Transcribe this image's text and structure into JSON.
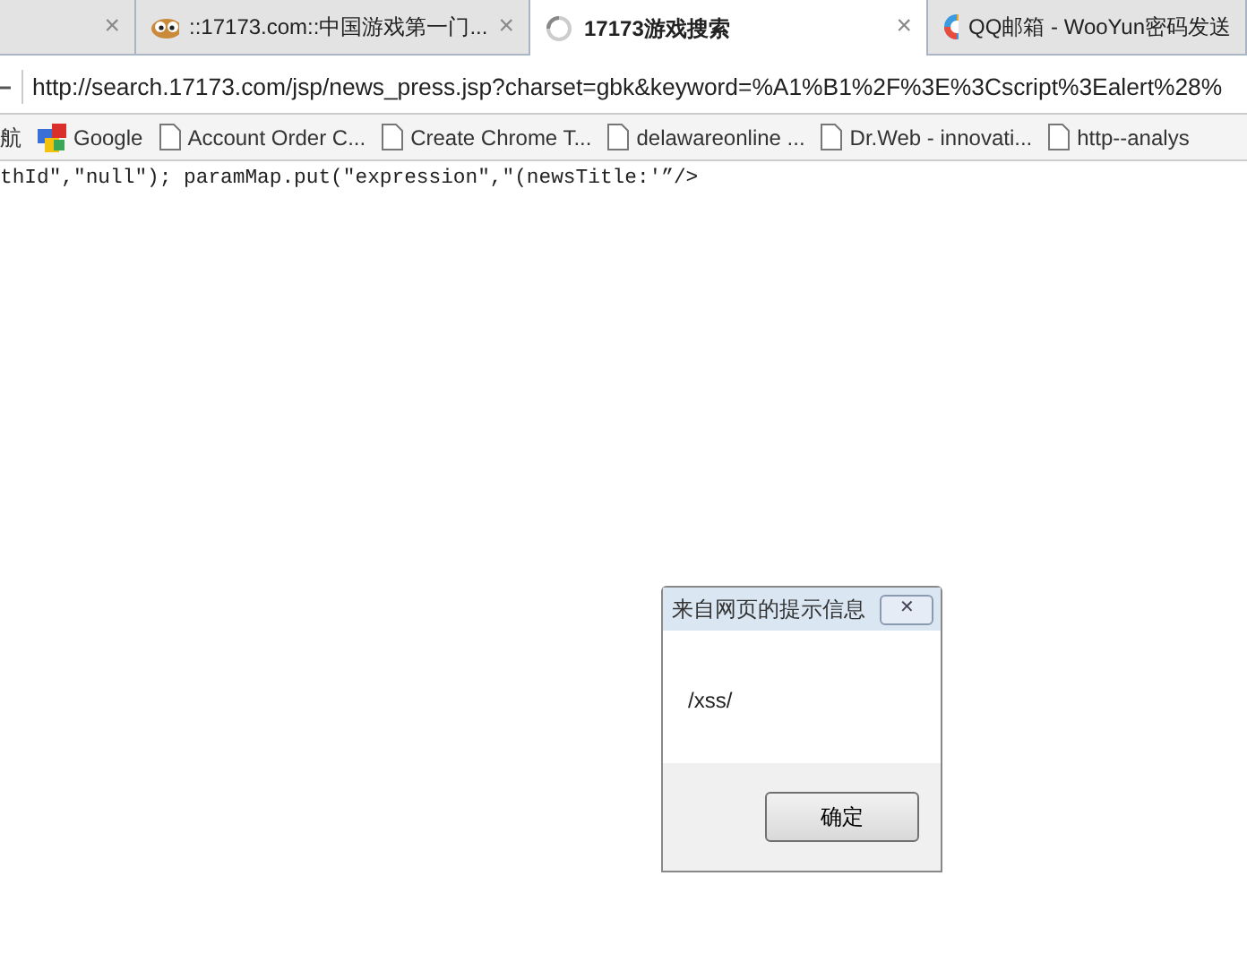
{
  "tabs": [
    {
      "kind": "blank",
      "close": "×",
      "selected": false
    },
    {
      "kind": "face",
      "title": "::17173.com::中国游戏第一门...",
      "close": "×",
      "selected": false
    },
    {
      "kind": "loading",
      "title": "17173游戏搜索",
      "close": "×",
      "selected": true
    },
    {
      "kind": "circle",
      "title": "QQ邮箱 - WooYun密码发送",
      "selected": false
    }
  ],
  "address_bar": {
    "url": "http://search.17173.com/jsp/news_press.jsp?charset=gbk&keyword=%A1%B1%2F%3E%3Cscript%3Ealert%28%"
  },
  "bookmarks": [
    {
      "kind": "text",
      "label": "航"
    },
    {
      "kind": "google",
      "label": "Google"
    },
    {
      "kind": "page",
      "label": "Account Order C..."
    },
    {
      "kind": "page",
      "label": "Create Chrome T..."
    },
    {
      "kind": "page",
      "label": "delawareonline ..."
    },
    {
      "kind": "page",
      "label": "Dr.Web - innovati..."
    },
    {
      "kind": "page",
      "label": "http--analys"
    }
  ],
  "page_source": "thId\",\"null\"); paramMap.put(\"expression\",\"(newsTitle:'”/>",
  "dialog": {
    "title": "来自网页的提示信息",
    "close": "✕",
    "message": "/xss/",
    "buttons": [
      "确定"
    ]
  }
}
